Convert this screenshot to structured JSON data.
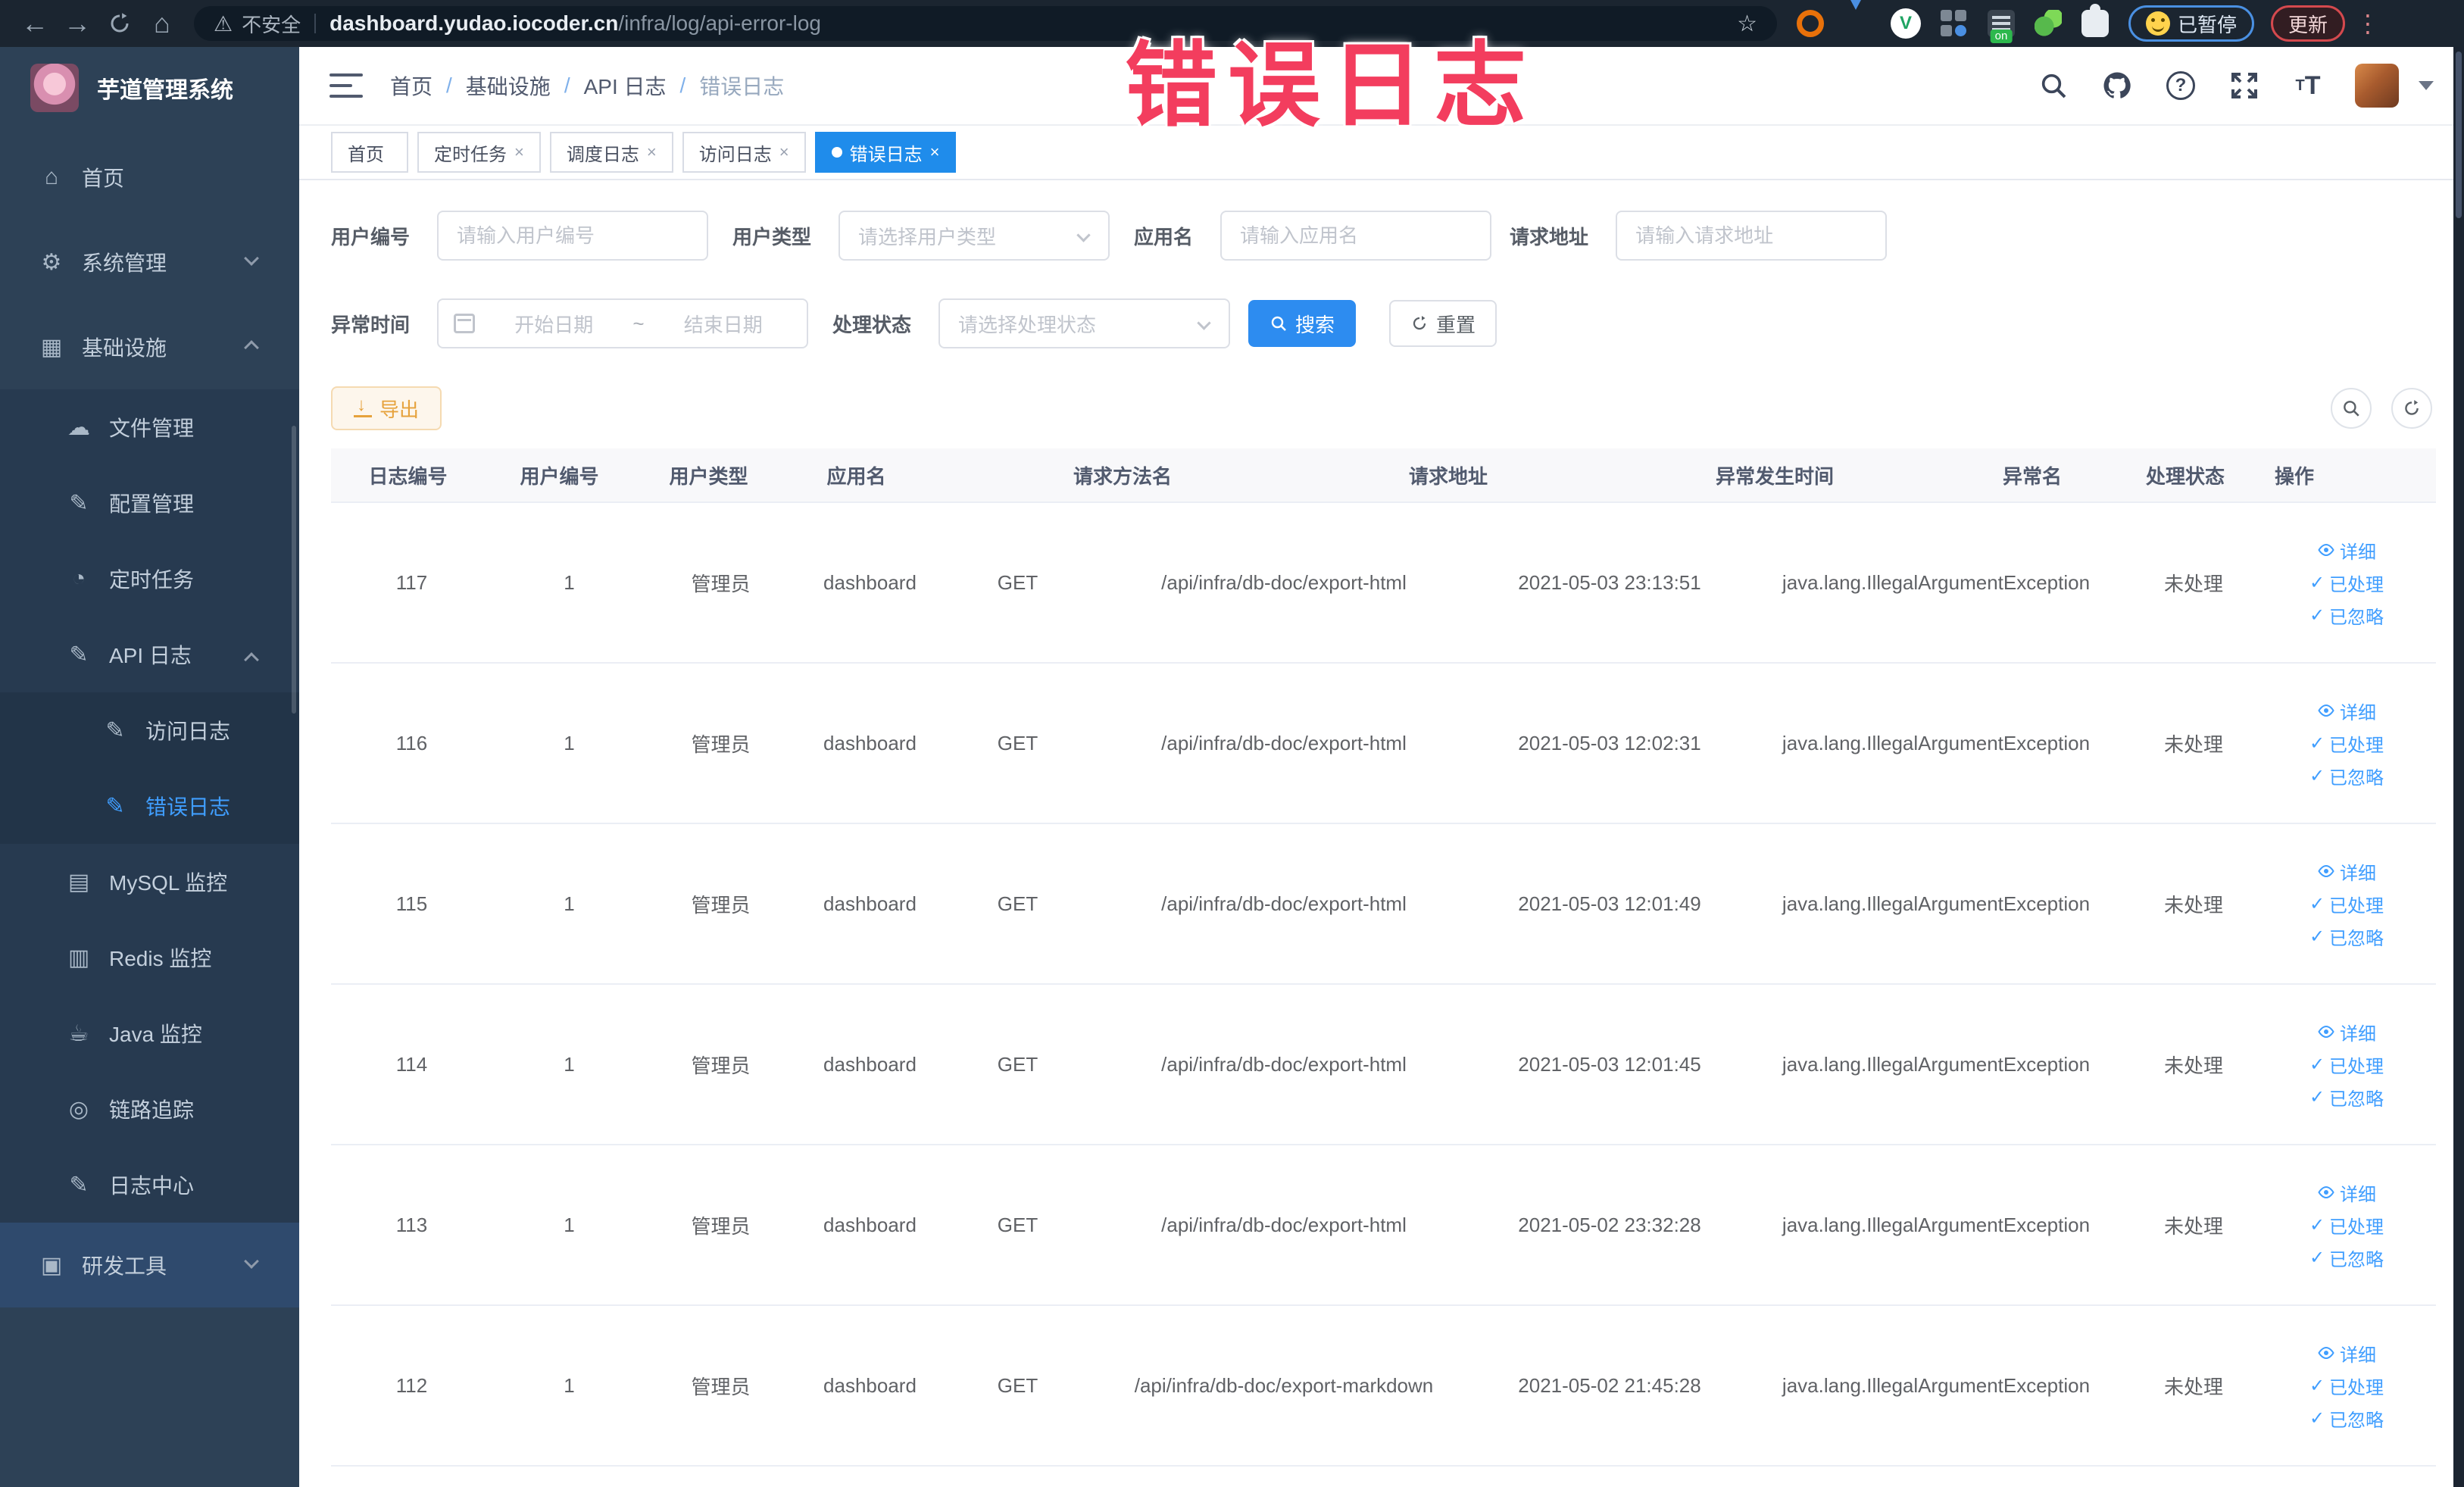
{
  "watermark": "错误日志",
  "browser": {
    "security_label": "不安全",
    "url_domain": "dashboard.yudao.iocoder.cn",
    "url_path": "/infra/log/api-error-log",
    "ext_on_label": "on",
    "paused_label": "已暂停",
    "update_label": "更新"
  },
  "sidebar": {
    "title": "芋道管理系统",
    "items": [
      {
        "label": "首页",
        "glyph": "⌂",
        "cls": "l1"
      },
      {
        "label": "系统管理",
        "glyph": "⚙",
        "cls": "l1 down"
      },
      {
        "label": "基础设施",
        "glyph": "▦",
        "cls": "l1 up"
      },
      {
        "label": "文件管理",
        "glyph": "☁",
        "cls": "l2"
      },
      {
        "label": "配置管理",
        "glyph": "✎",
        "cls": "l2"
      },
      {
        "label": "定时任务",
        "glyph": "◔",
        "cls": "l2"
      },
      {
        "label": "API 日志",
        "glyph": "✎",
        "cls": "l2 up"
      },
      {
        "label": "访问日志",
        "glyph": "✎",
        "cls": "l3"
      },
      {
        "label": "错误日志",
        "glyph": "✎",
        "cls": "l3 active"
      },
      {
        "label": "MySQL 监控",
        "glyph": "▤",
        "cls": "l2"
      },
      {
        "label": "Redis 监控",
        "glyph": "▥",
        "cls": "l2"
      },
      {
        "label": "Java 监控",
        "glyph": "☕",
        "cls": "l2"
      },
      {
        "label": "链路追踪",
        "glyph": "◎",
        "cls": "l2"
      },
      {
        "label": "日志中心",
        "glyph": "✎",
        "cls": "l2"
      },
      {
        "label": "研发工具",
        "glyph": "▣",
        "cls": "l1 down light"
      }
    ]
  },
  "breadcrumb": {
    "separator": "/",
    "items": [
      {
        "label": "首页"
      },
      {
        "label": "基础设施"
      },
      {
        "label": "API 日志"
      }
    ],
    "current": "错误日志"
  },
  "tabs": [
    {
      "label": "首页",
      "cls": "",
      "close": ""
    },
    {
      "label": "定时任务",
      "cls": "",
      "close": "×"
    },
    {
      "label": "调度日志",
      "cls": "",
      "close": "×"
    },
    {
      "label": "访问日志",
      "cls": "",
      "close": "×"
    },
    {
      "label": "错误日志",
      "cls": "active",
      "close": "×"
    }
  ],
  "filters": {
    "user_id_label": "用户编号",
    "user_id_placeholder": "请输入用户编号",
    "user_type_label": "用户类型",
    "user_type_placeholder": "请选择用户类型",
    "app_name_label": "应用名",
    "app_name_placeholder": "请输入应用名",
    "request_url_label": "请求地址",
    "request_url_placeholder": "请输入请求地址",
    "exception_time_label": "异常时间",
    "date_start_placeholder": "开始日期",
    "date_range_separator": "~",
    "date_end_placeholder": "结束日期",
    "process_status_label": "处理状态",
    "process_status_placeholder": "请选择处理状态",
    "search_label": "搜索",
    "reset_label": "重置"
  },
  "toolbar": {
    "export_label": "导出"
  },
  "table": {
    "columns": [
      {
        "label": "日志编号"
      },
      {
        "label": "用户编号"
      },
      {
        "label": "用户类型"
      },
      {
        "label": "应用名"
      },
      {
        "label": "请求方法名"
      },
      {
        "label": "请求地址"
      },
      {
        "label": "异常发生时间"
      },
      {
        "label": "异常名"
      },
      {
        "label": "处理状态"
      },
      {
        "label": "操作"
      }
    ],
    "actions": [
      "详细",
      "已处理",
      "已忽略"
    ],
    "rows": [
      {
        "id": "117",
        "user": "1",
        "type": "管理员",
        "app": "dashboard",
        "method": "GET",
        "url": "/api/infra/db-doc/export-html",
        "time": "2021-05-03 23:13:51",
        "exc": "java.lang.IllegalArgumentException",
        "status": "未处理"
      },
      {
        "id": "116",
        "user": "1",
        "type": "管理员",
        "app": "dashboard",
        "method": "GET",
        "url": "/api/infra/db-doc/export-html",
        "time": "2021-05-03 12:02:31",
        "exc": "java.lang.IllegalArgumentException",
        "status": "未处理"
      },
      {
        "id": "115",
        "user": "1",
        "type": "管理员",
        "app": "dashboard",
        "method": "GET",
        "url": "/api/infra/db-doc/export-html",
        "time": "2021-05-03 12:01:49",
        "exc": "java.lang.IllegalArgumentException",
        "status": "未处理"
      },
      {
        "id": "114",
        "user": "1",
        "type": "管理员",
        "app": "dashboard",
        "method": "GET",
        "url": "/api/infra/db-doc/export-html",
        "time": "2021-05-03 12:01:45",
        "exc": "java.lang.IllegalArgumentException",
        "status": "未处理"
      },
      {
        "id": "113",
        "user": "1",
        "type": "管理员",
        "app": "dashboard",
        "method": "GET",
        "url": "/api/infra/db-doc/export-html",
        "time": "2021-05-02 23:32:28",
        "exc": "java.lang.IllegalArgumentException",
        "status": "未处理"
      },
      {
        "id": "112",
        "user": "1",
        "type": "管理员",
        "app": "dashboard",
        "method": "GET",
        "url": "/api/infra/db-doc/export-markdown",
        "time": "2021-05-02 21:45:28",
        "exc": "java.lang.IllegalArgumentException",
        "status": "未处理"
      }
    ]
  }
}
